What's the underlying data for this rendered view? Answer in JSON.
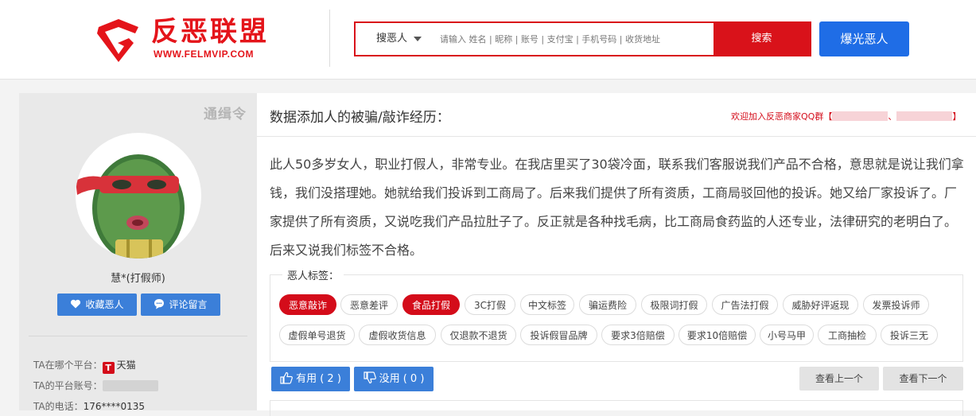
{
  "header": {
    "logo_text": "反恶联盟",
    "logo_url": "WWW.FELMVIP.COM",
    "search_type": "搜恶人",
    "search_placeholder": "请输入 姓名 | 昵称 | 账号 | 支付宝 | 手机号码 | 收货地址",
    "search_button": "搜索",
    "expose_button": "爆光恶人",
    "brand_color": "#e4141a",
    "blue_color": "#1f6de6"
  },
  "profile": {
    "stamp_text": "通缉令",
    "name": "慧*(打假师)",
    "favorite_button": "收藏恶人",
    "comment_button": "评论留言",
    "platform_label": "TA在哪个平台：",
    "platform_icon_letter": "T",
    "platform_value": "天猫",
    "account_label": "TA的平台账号：",
    "phone_label": "TA的电话：",
    "phone_value": "176****0135"
  },
  "experience": {
    "title": "数据添加人的被骗/敲诈经历：",
    "qq_text": "欢迎加入反恶商家QQ群【",
    "qq_separator": "、",
    "qq_end": "】",
    "body": "此人50多岁女人，职业打假人，非常专业。在我店里买了30袋冷面，联系我们客服说我们产品不合格，意思就是说让我们拿钱，我们没搭理她。她就给我们投诉到工商局了。后来我们提供了所有资质，工商局驳回他的投诉。她又给厂家投诉了。厂家提供了所有资质，又说吃我们产品拉肚子了。反正就是各种找毛病，比工商局食药监的人还专业，法律研究的老明白了。后来又说我们标签不合格。"
  },
  "tags": {
    "legend": "恶人标签：",
    "row1": [
      "恶意敲诈",
      "恶意差评",
      "食品打假",
      "3C打假",
      "中文标签",
      "骗运费险",
      "极限词打假",
      "广告法打假",
      "威胁好评返现",
      "发票投诉师"
    ],
    "row2": [
      "虚假单号退货",
      "虚假收货信息",
      "仅退款不退货",
      "投诉假冒品牌",
      "要求3倍赔偿",
      "要求10倍赔偿",
      "小号马甲",
      "工商抽检",
      "投诉三无"
    ],
    "active": [
      "恶意敲诈",
      "食品打假"
    ]
  },
  "actions": {
    "useful_label": "有用 ( 2 )",
    "useless_label": "没用 ( 0 )",
    "prev_label": "查看上一个",
    "next_label": "查看下一个"
  }
}
